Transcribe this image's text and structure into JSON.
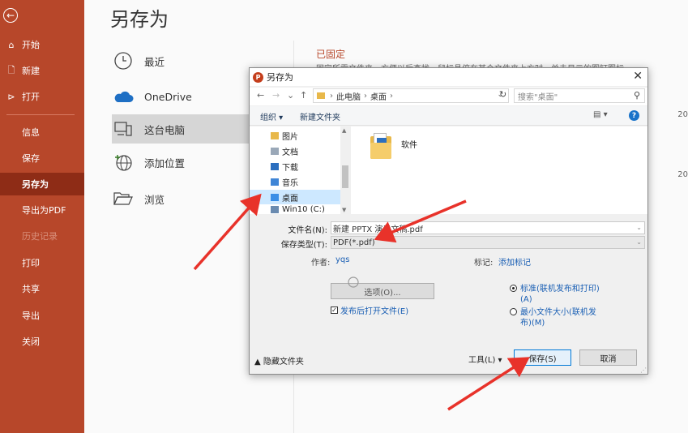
{
  "sidebar": {
    "items": [
      {
        "label": "开始",
        "icon": "home-icon",
        "glyph": "⌂"
      },
      {
        "label": "新建",
        "icon": "new-doc-icon",
        "glyph": "🗋"
      },
      {
        "label": "打开",
        "icon": "open-folder-icon",
        "glyph": "⊳"
      },
      {
        "label": "信息"
      },
      {
        "label": "保存"
      },
      {
        "label": "另存为"
      },
      {
        "label": "导出为PDF"
      },
      {
        "label": "历史记录"
      },
      {
        "label": "打印"
      },
      {
        "label": "共享"
      },
      {
        "label": "导出"
      },
      {
        "label": "关闭"
      }
    ],
    "back_glyph": "←",
    "accent": "#b7472a"
  },
  "main": {
    "title": "另存为",
    "locations": [
      {
        "label": "最近"
      },
      {
        "label": "OneDrive"
      },
      {
        "label": "这台电脑"
      },
      {
        "label": "添加位置"
      },
      {
        "label": "浏览"
      }
    ],
    "pinned_heading": "已固定",
    "pinned_desc": "固定所需文件夹，方便以后查找。鼠标悬停在某个文件夹上方时，单击显示的图钉图标。",
    "date_fragments": [
      "20",
      "20"
    ]
  },
  "dialog": {
    "title": "另存为",
    "close_glyph": "✕",
    "nav": {
      "back": "←",
      "forward": "→",
      "recent": "⌄",
      "up": "↑"
    },
    "address_crumbs": [
      "此电脑",
      "桌面"
    ],
    "refresh_glyph": "↻",
    "search_placeholder": "搜索\"桌面\"",
    "toolbar": {
      "organize": "组织 ▾",
      "new_folder": "新建文件夹",
      "view": "▤ ▾",
      "help": "?"
    },
    "tree_items": [
      {
        "label": "图片"
      },
      {
        "label": "文档"
      },
      {
        "label": "下载"
      },
      {
        "label": "音乐"
      },
      {
        "label": "桌面"
      },
      {
        "label": "Win10 (C:)"
      }
    ],
    "files": [
      {
        "label": "软件"
      }
    ],
    "filename_label": "文件名(N):",
    "filename_value": "新建 PPTX 演示文稿.pdf",
    "filetype_label": "保存类型(T):",
    "filetype_value": "PDF(*.pdf)",
    "author_label": "作者:",
    "author_value": "yqs",
    "tags_label": "标记:",
    "tags_value": "添加标记",
    "options_button": "选项(O)...",
    "open_after_publish": "发布后打开文件(E)",
    "optimize_standard": "标准(联机发布和打印)",
    "optimize_standard_key": "(A)",
    "optimize_min": "最小文件大小(联机发",
    "optimize_min_2": "布)(M)",
    "hide_folders": "▲ 隐藏文件夹",
    "tools": "工具(L)  ▾",
    "save_button": "保存(S)",
    "cancel_button": "取消"
  }
}
